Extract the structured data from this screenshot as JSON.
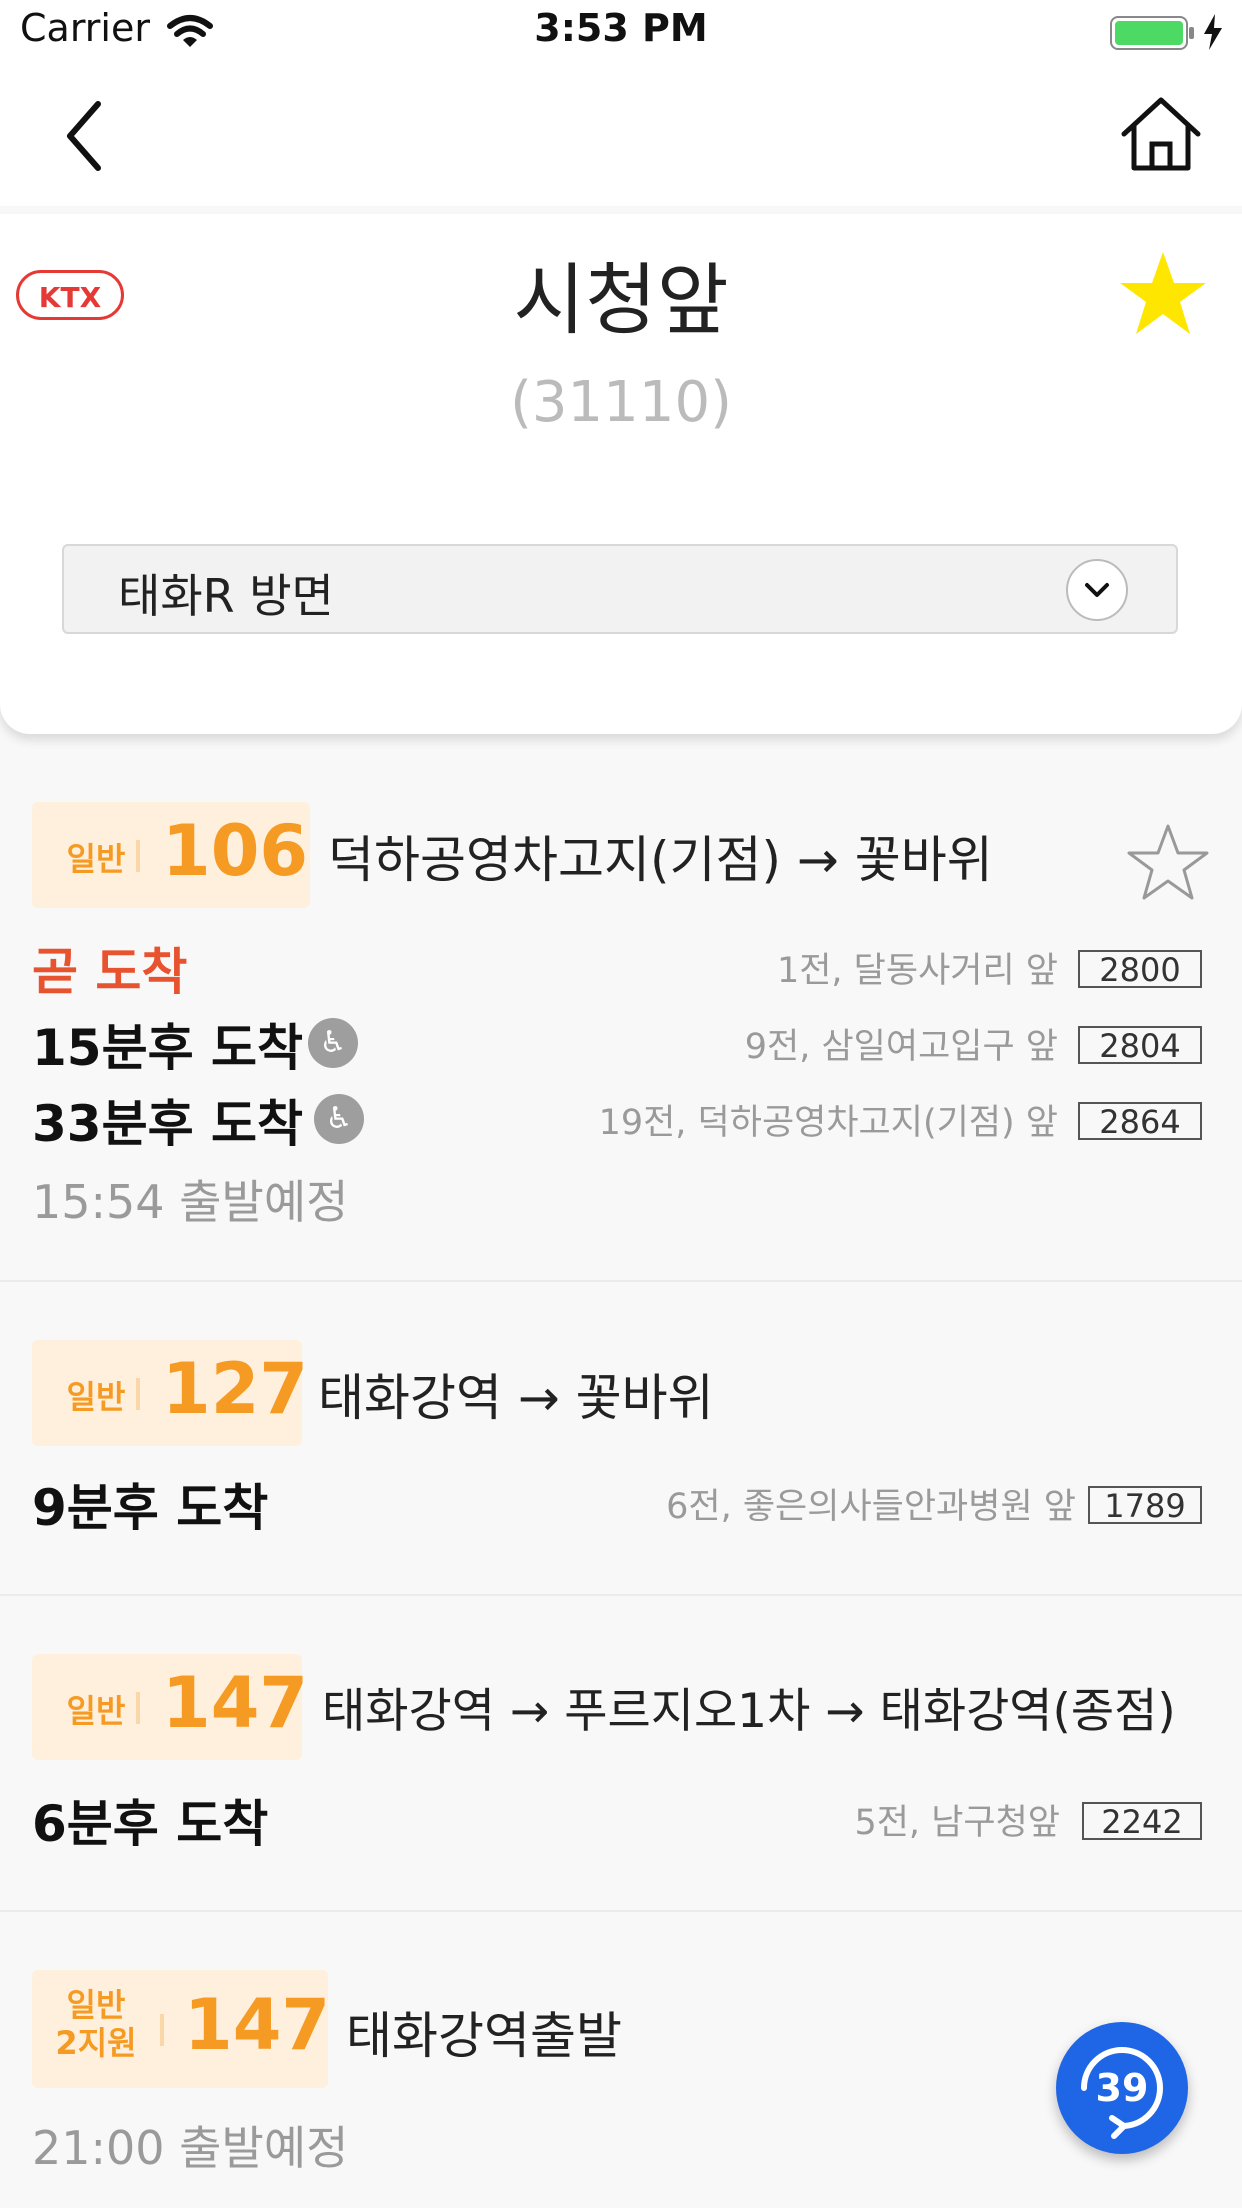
{
  "status_bar": {
    "carrier": "Carrier",
    "time": "3:53 PM"
  },
  "nav": {
    "back_icon": "chevron-left-icon",
    "home_icon": "home-icon"
  },
  "stop": {
    "badge": "KTX",
    "name": "시청앞",
    "id": "(31110)",
    "direction": "태화R 방면",
    "favorite_color": "#FFE600"
  },
  "routes": [
    {
      "type": "일반",
      "number": "106",
      "path": "덕하공영차고지(기점) → 꽃바위",
      "arrivals": [
        {
          "text": "곧 도착",
          "info": "1전, 달동사거리 앞",
          "plate": "2800"
        },
        {
          "text": "15분후 도착",
          "info": "9전, 삼일여고입구 앞",
          "plate": "2804"
        },
        {
          "text": "33분후 도착",
          "info": "19전, 덕하공영차고지(기점) 앞",
          "plate": "2864"
        }
      ],
      "schedule": "15:54 출발예정"
    },
    {
      "type": "일반",
      "number": "127",
      "path": "태화강역 → 꽃바위",
      "arrivals": [
        {
          "text": "9분후 도착",
          "info": "6전, 좋은의사들안과병원 앞",
          "plate": "1789"
        }
      ]
    },
    {
      "type": "일반",
      "number": "147",
      "path": "태화강역 → 푸르지오1차 → 태화강역(종점)",
      "arrivals": [
        {
          "text": "6분후 도착",
          "info": "5전, 남구청앞",
          "plate": "2242"
        }
      ]
    },
    {
      "type_line1": "일반",
      "type_line2": "2지원",
      "number": "147",
      "path": "태화강역출발",
      "schedule": "21:00 출발예정"
    }
  ],
  "refresh": {
    "countdown": "39"
  },
  "colors": {
    "accent_orange": "#F59A23",
    "arriving_red": "#E8532F",
    "fab_blue": "#1F66E6"
  }
}
